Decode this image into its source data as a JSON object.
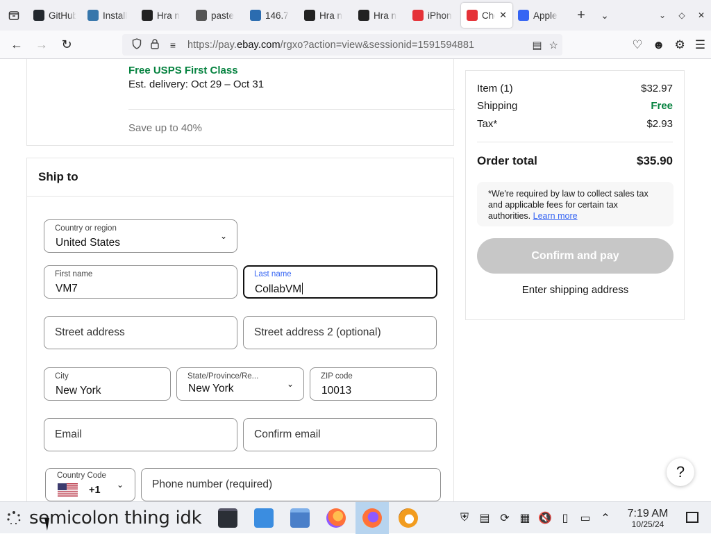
{
  "browser": {
    "tabs": [
      {
        "title": "GitHub",
        "icon": "github-icon",
        "color": "#24292f"
      },
      {
        "title": "Install",
        "icon": "python-icon",
        "color": "#3776ab"
      },
      {
        "title": "Hra n",
        "icon": "hra-icon",
        "color": "#222222"
      },
      {
        "title": "paste",
        "icon": "paste-icon",
        "color": "#555555"
      },
      {
        "title": "146.7",
        "icon": "shield-icon",
        "color": "#2b6cb0"
      },
      {
        "title": "Hra n",
        "icon": "hra-icon",
        "color": "#222222"
      },
      {
        "title": "Hra n",
        "icon": "hra-icon",
        "color": "#222222"
      },
      {
        "title": "iPhon",
        "icon": "iphone-store-icon",
        "color": "#e53238"
      },
      {
        "title": "Che",
        "icon": "ebay-bag-icon",
        "color": "#e53238",
        "active": true
      },
      {
        "title": "Apple",
        "icon": "apple-store-icon",
        "color": "#3665f3"
      }
    ],
    "url_prefix": "https://pay.",
    "url_domain": "ebay.com",
    "url_rest": "/rgxo?action=view&sessionid=1591594881"
  },
  "delivery": {
    "shipping_method": "Free USPS First Class",
    "est_delivery": "Est. delivery: Oct 29 – Oct 31",
    "save_note": "Save up to 40%"
  },
  "ship_to": {
    "heading": "Ship to",
    "country_label": "Country or region",
    "country_value": "United States",
    "first_name_label": "First name",
    "first_name_value": "VM7",
    "last_name_label": "Last name",
    "last_name_value": "CollabVM",
    "street_placeholder": "Street address",
    "street2_placeholder": "Street address 2 (optional)",
    "city_label": "City",
    "city_value": "New York",
    "state_label": "State/Province/Re...",
    "state_value": "New York",
    "zip_label": "ZIP code",
    "zip_value": "10013",
    "email_placeholder": "Email",
    "confirm_email_placeholder": "Confirm email",
    "country_code_label": "Country Code",
    "country_code_value": "+1",
    "phone_placeholder": "Phone number (required)"
  },
  "summary": {
    "item_label": "Item (1)",
    "item_value": "$32.97",
    "shipping_label": "Shipping",
    "shipping_value": "Free",
    "tax_label": "Tax*",
    "tax_value": "$2.93",
    "total_label": "Order total",
    "total_value": "$35.90",
    "tax_note": "*We're required by law to collect sales tax and applicable fees for certain tax authorities.",
    "learn_more": "Learn more",
    "pay_button": "Confirm and pay",
    "enter_shipping": "Enter shipping address"
  },
  "help_label": "?",
  "taskbar": {
    "window_title": "semicolon thing idk",
    "time": "7:19 AM",
    "date": "10/25/24"
  }
}
